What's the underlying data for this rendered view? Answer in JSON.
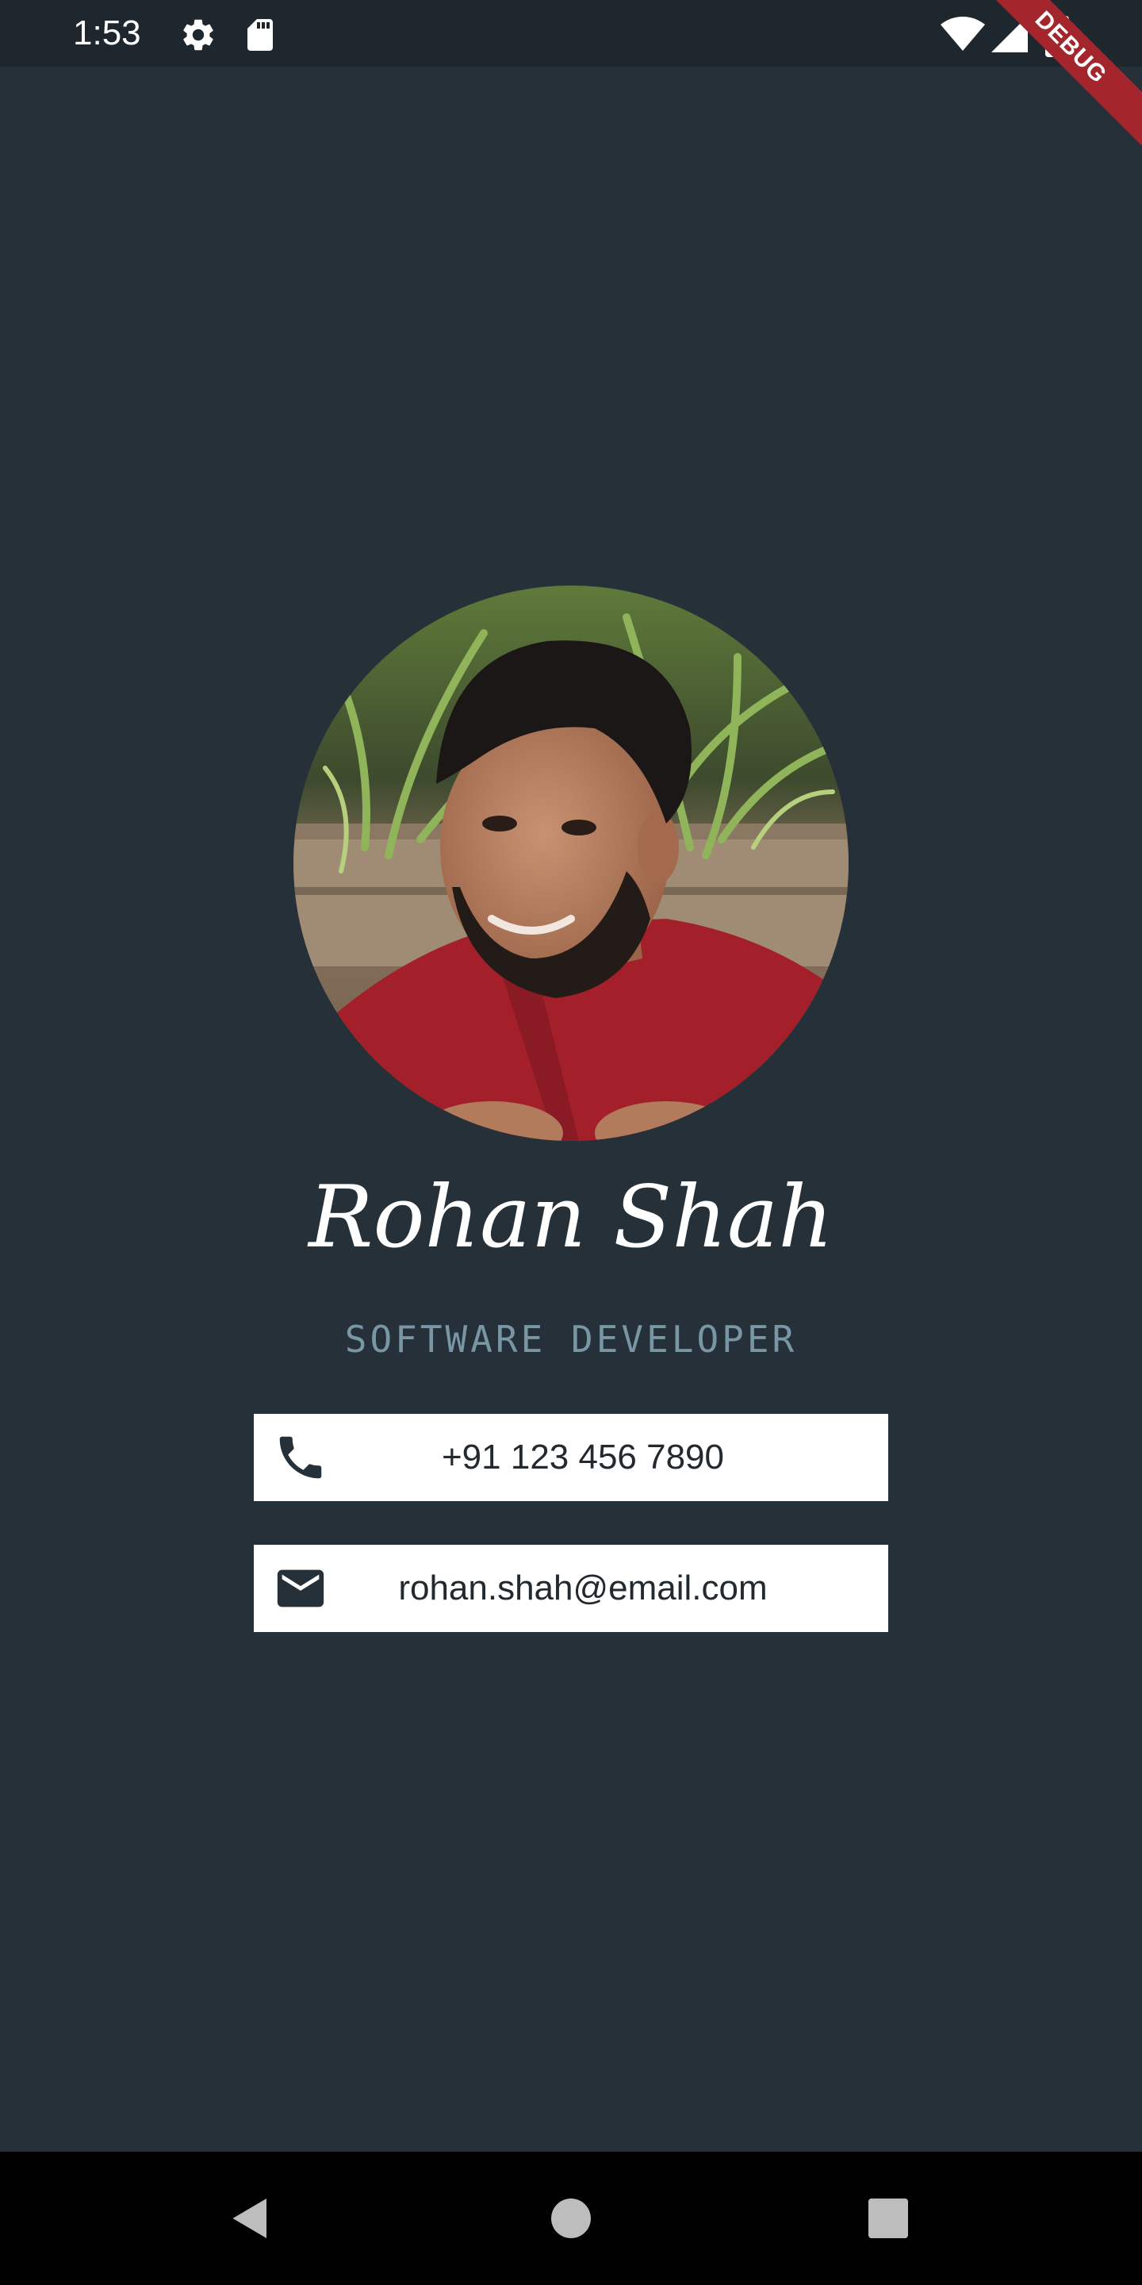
{
  "status_bar": {
    "time": "1:53",
    "icons": [
      "gear-icon",
      "sd-card-icon",
      "wifi-icon",
      "signal-icon",
      "battery-icon"
    ],
    "debug_label": "DEBUG"
  },
  "profile": {
    "name": "Rohan Shah",
    "title": "SOFTWARE DEVELOPER",
    "avatar_icon": "profile-photo"
  },
  "contacts": {
    "phone": {
      "icon": "phone-icon",
      "value": "+91 123 456 7890"
    },
    "email": {
      "icon": "mail-icon",
      "value": "rohan.shah@email.com"
    }
  },
  "nav_bar": {
    "buttons": [
      "back-icon",
      "home-icon",
      "recents-icon"
    ]
  },
  "colors": {
    "background": "#263038",
    "card": "#ffffff",
    "accent_text": "#7996a4",
    "icon": "#263038",
    "debug": "#a4262c"
  }
}
